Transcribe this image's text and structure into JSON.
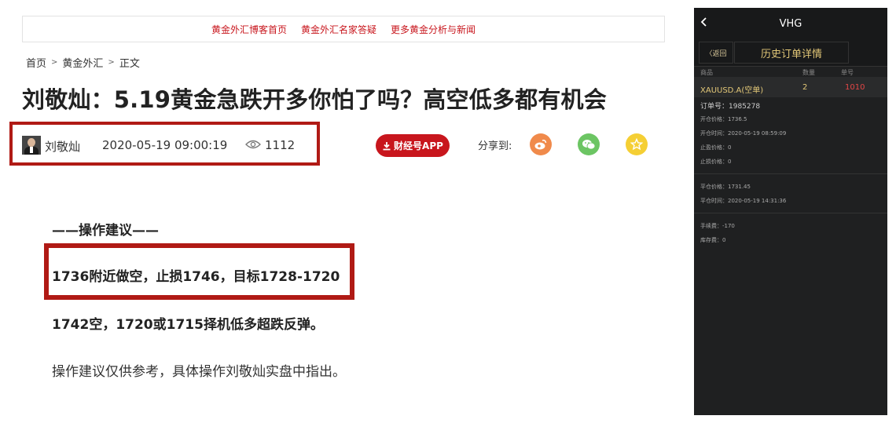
{
  "topnav": [
    "黄金外汇博客首页",
    "黄金外汇名家答疑",
    "更多黄金分析与新闻"
  ],
  "breadcrumb": {
    "home": "首页",
    "category": "黄金外汇",
    "current": "正文",
    "sep": ">"
  },
  "article": {
    "title": "刘敬灿：5.19黄金急跌开多你怕了吗？高空低多都有机会",
    "author": "刘敬灿",
    "date": "2020-05-19 09:00:19",
    "views": "1112",
    "app_button": "财经号APP",
    "share_label": "分享到:",
    "paragraphs": [
      "——操作建议——",
      "1736附近做空，止损1746，目标1728-1720",
      "1742空，1720或1715择机低多超跌反弹。",
      "操作建议仅供参考，具体操作刘敬灿实盘中指出。"
    ]
  },
  "colors": {
    "accent": "#c8161d",
    "highlight_border": "#b01a15",
    "gold": "#e3c878",
    "red_value": "#e34646"
  },
  "phone": {
    "title": "VHG",
    "back_icon": "chevron-left-icon",
    "return_label": "〈返回",
    "subtitle": "历史订单详情",
    "columns": [
      "商品",
      "数量",
      "单号"
    ],
    "row": {
      "symbol": "XAUUSD.A(空单)",
      "qty": "2",
      "number": "1010"
    },
    "order_no": "订单号：1985278",
    "open_price": "开仓价格：1736.5",
    "open_time": "开仓时间：2020-05-19 08:59:09",
    "tp": "止盈价格：0",
    "sl": "止损价格：0",
    "close_price": "平仓价格：1731.45",
    "close_time": "平仓时间：2020-05-19 14:31:36",
    "fee": "手续费：-170",
    "storage": "库存费：0"
  }
}
